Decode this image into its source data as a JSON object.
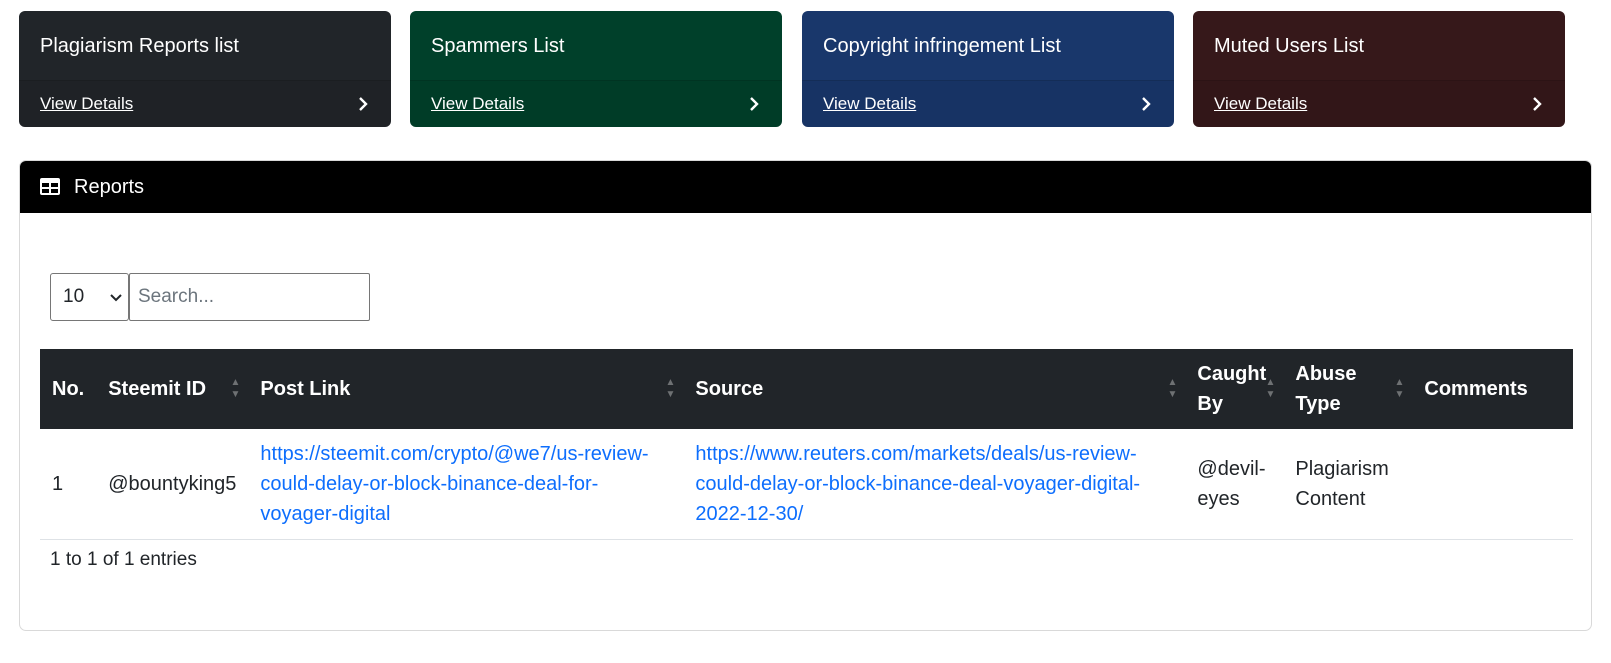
{
  "cards": [
    {
      "title": "Plagiarism Reports list",
      "link": "View Details",
      "color": "#212529"
    },
    {
      "title": "Spammers List",
      "link": "View Details",
      "color": "#00402a"
    },
    {
      "title": "Copyright infringement List",
      "link": "View Details",
      "color": "#19376b"
    },
    {
      "title": "Muted Users List",
      "link": "View Details",
      "color": "#36181a"
    }
  ],
  "panel": {
    "title": "Reports",
    "page_size": "10",
    "search_placeholder": "Search...",
    "columns": [
      "No.",
      "Steemit ID",
      "Post Link",
      "Source",
      "Caught By",
      "Abuse Type",
      "Comments"
    ],
    "rows": [
      {
        "no": "1",
        "steemit_id": "@bountyking5",
        "post_link": "https://steemit.com/crypto/@we7/us-review-could-delay-or-block-binance-deal-for-voyager-digital",
        "source": "https://www.reuters.com/markets/deals/us-review-could-delay-or-block-binance-deal-voyager-digital-2022-12-30/",
        "caught_by": "@devil-eyes",
        "abuse_type": "Plagiarism Content",
        "comments": ""
      }
    ],
    "info": "1 to 1 of 1 entries"
  }
}
